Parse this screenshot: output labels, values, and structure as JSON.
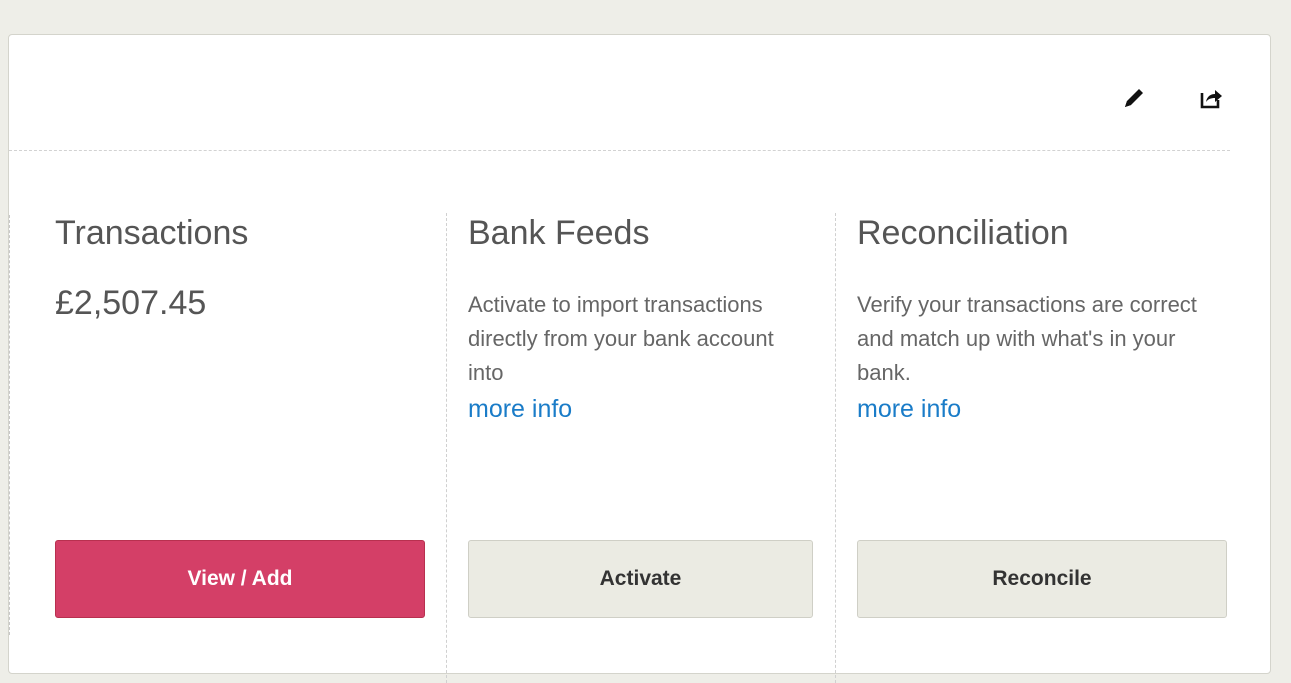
{
  "header": {
    "edit_icon": "pencil-icon",
    "share_icon": "share-icon"
  },
  "panels": {
    "transactions": {
      "title": "Transactions",
      "amount": "£2,507.45",
      "button": "View / Add"
    },
    "bank_feeds": {
      "title": "Bank Feeds",
      "description": "Activate to import transactions directly from your bank account into",
      "link": "more info",
      "button": "Activate"
    },
    "reconciliation": {
      "title": "Reconciliation",
      "description": "Verify your transactions are correct and match up with what's in your bank.",
      "link": "more info",
      "button": "Reconcile"
    }
  },
  "colors": {
    "primary": "#d43f67",
    "link": "#1a7cc8",
    "secondary_button": "#ebebe3",
    "background": "#eeeee8"
  }
}
